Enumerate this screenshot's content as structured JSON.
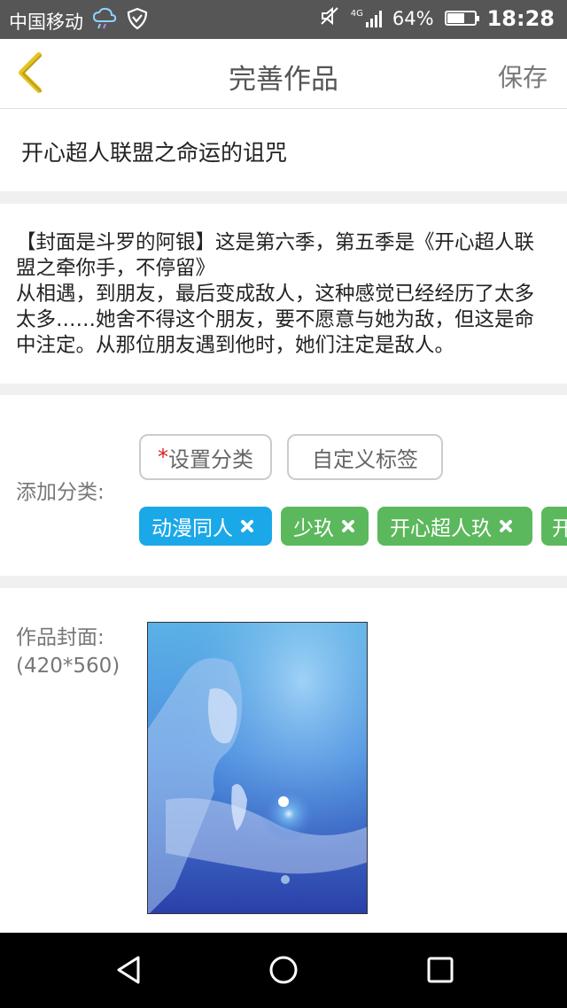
{
  "status_bar": {
    "carrier": "中国移动",
    "battery": "64%",
    "battery_level": 0.64,
    "time": "18:28",
    "network": "4G"
  },
  "header": {
    "title": "完善作品",
    "save_label": "保存",
    "accent_color": "#e8c21d"
  },
  "work": {
    "title": "开心超人联盟之命运的诅咒",
    "description": "【封面是斗罗的阿银】这是第六季，第五季是《开心超人联盟之牵你手，不停留》\n从相遇，到朋友，最后变成敌人，这种感觉已经经历了太多太多……她舍不得这个朋友，要不愿意与她为敌，但这是命中注定。从那位朋友遇到他时，她们注定是敌人。"
  },
  "category": {
    "label": "添加分类:",
    "set_category_required_mark": "*",
    "set_category_label": "设置分类",
    "custom_tag_label": "自定义标签",
    "tags": [
      {
        "label": "动漫同人",
        "color": "#1aa8e8"
      },
      {
        "label": "少玖",
        "color": "#5cb85c"
      },
      {
        "label": "开心超人玖",
        "color": "#5cb85c"
      },
      {
        "label": "开",
        "color": "#5cb85c"
      }
    ]
  },
  "cover": {
    "label": "作品封面:",
    "size_hint": "(420*560)"
  },
  "icons": {
    "back": "chevron-left-icon",
    "weather": "cloud-rain-icon",
    "vpn": "shield-check-icon",
    "mute": "speaker-off-icon",
    "signal": "signal-icon",
    "battery": "battery-icon",
    "nav_back": "triangle-back-icon",
    "nav_home": "circle-home-icon",
    "nav_recent": "square-recent-icon"
  }
}
